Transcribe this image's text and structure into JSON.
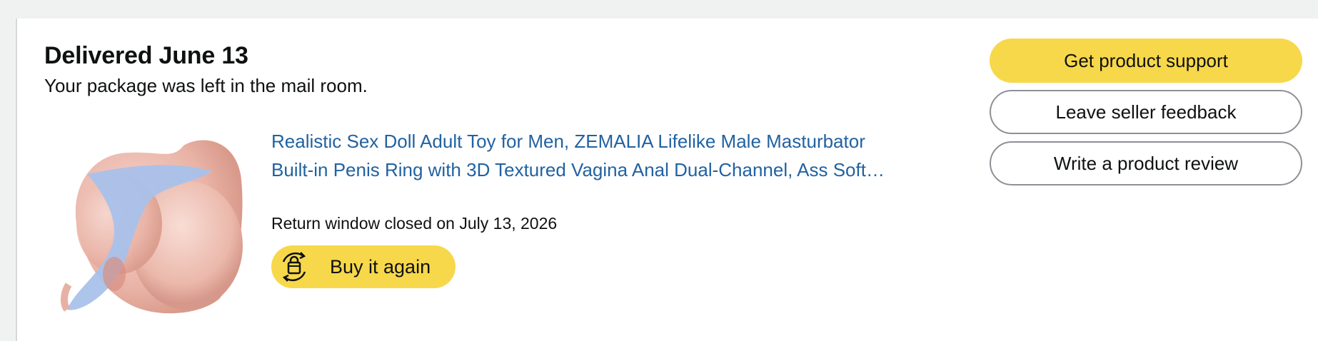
{
  "shipment": {
    "status_title": "Delivered June 13",
    "status_detail": "Your package was left in the mail room."
  },
  "product": {
    "title_line1": "Realistic Sex Doll Adult Toy for Men, ZEMALIA Lifelike Male Masturbator",
    "title_line2": "Built-in Penis Ring with 3D Textured Vagina Anal Dual-Channel, Ass Soft…",
    "return_window": "Return window closed on July 13, 2026",
    "image_icon": "product-image"
  },
  "buy_again": {
    "label": "Buy it again",
    "icon": "reorder-bag-icon"
  },
  "actions": {
    "support": "Get product support",
    "feedback": "Leave seller feedback",
    "review": "Write a product review"
  },
  "colors": {
    "page_background": "#f0f2f2",
    "link": "#2162a1",
    "primary_button": "#f7d84a",
    "secondary_button_border": "#8d9096",
    "text": "#0f1111"
  }
}
